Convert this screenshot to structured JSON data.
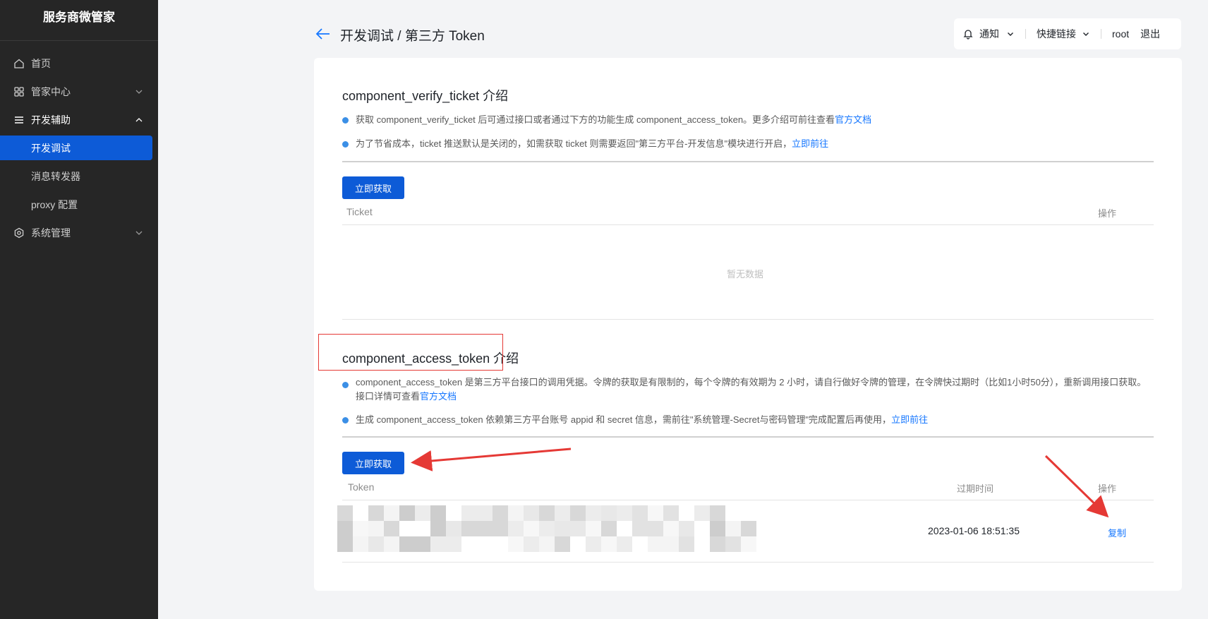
{
  "sidebar": {
    "brand": "服务商微管家",
    "items": [
      {
        "label": "首页",
        "icon": "home-icon"
      },
      {
        "label": "管家中心",
        "icon": "grid-icon"
      },
      {
        "label": "开发辅助",
        "icon": "menu-icon"
      },
      {
        "label": "系统管理",
        "icon": "hexagon-gear-icon"
      }
    ],
    "sub_items": [
      {
        "label": "开发调试"
      },
      {
        "label": "消息转发器"
      },
      {
        "label": "proxy 配置"
      }
    ]
  },
  "header": {
    "title": "开发调试 / 第三方 Token",
    "notify_label": "通知",
    "quick_links_label": "快捷链接",
    "user": "root",
    "logout": "退出"
  },
  "ticket_section": {
    "title": "component_verify_ticket 介绍",
    "bullet1_text": "获取 component_verify_ticket 后可通过接口或者通过下方的功能生成 component_access_token。更多介绍可前往查看",
    "bullet1_link": "官方文档",
    "bullet2_text": "为了节省成本，ticket 推送默认是关闭的，如需获取 ticket 则需要返回\"第三方平台-开发信息\"模块进行开启，",
    "bullet2_link": "立即前往",
    "button": "立即获取",
    "col_ticket": "Ticket",
    "col_action": "操作",
    "empty": "暂无数据"
  },
  "token_section": {
    "title": "component_access_token 介绍",
    "bullet1_text": "component_access_token 是第三方平台接口的调用凭据。令牌的获取是有限制的，每个令牌的有效期为 2 小时，请自行做好令牌的管理，在令牌快过期时（比如1小时50分），重新调用接口获取。接口详情可查看",
    "bullet1_link": "官方文档",
    "bullet2_text": "生成 component_access_token 依赖第三方平台账号 appid 和 secret 信息，需前往\"系统管理-Secret与密码管理\"完成配置后再使用，",
    "bullet2_link": "立即前往",
    "button": "立即获取",
    "col_token": "Token",
    "col_expire": "过期时间",
    "col_action": "操作",
    "rows": [
      {
        "expire": "2023-01-06 18:51:35",
        "action": "复制"
      }
    ]
  },
  "colors": {
    "sidebar_bg": "#262626",
    "accent": "#0d5bd7",
    "link": "#1677ff",
    "annotation": "#e53935"
  }
}
